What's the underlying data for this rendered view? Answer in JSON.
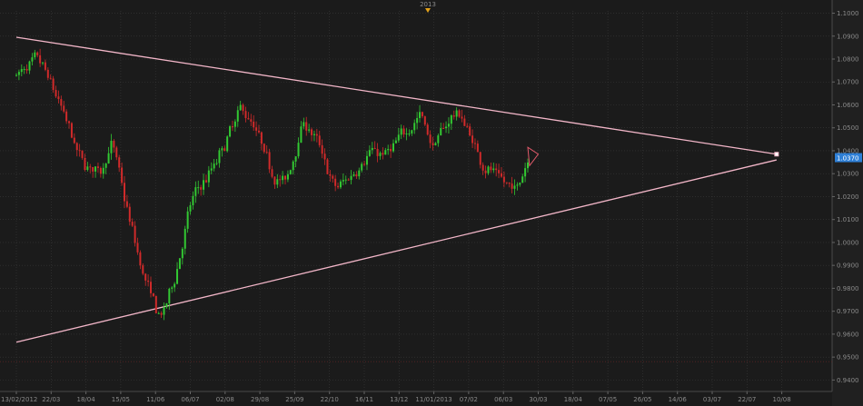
{
  "chart_data": {
    "type": "candlestick",
    "title": "",
    "xlabel": "",
    "ylabel": "",
    "grid": true,
    "ylim": [
      0.935,
      1.101
    ],
    "y_ticks": [
      "1.1000",
      "1.0900",
      "1.0800",
      "1.0700",
      "1.0600",
      "1.0500",
      "1.0400",
      "1.0300",
      "1.0200",
      "1.0100",
      "1.0000",
      "0.9900",
      "0.9800",
      "0.9700",
      "0.9600",
      "0.9500",
      "0.9400"
    ],
    "x_ticks": [
      "13/02/2012",
      "22/03",
      "18/04",
      "15/05",
      "11/06",
      "06/07",
      "02/08",
      "29/08",
      "25/09",
      "22/10",
      "16/11",
      "13/12",
      "11/01/2013",
      "07/02",
      "06/03",
      "30/03",
      "18/04",
      "07/05",
      "26/05",
      "14/06",
      "03/07",
      "22/07",
      "10/08"
    ],
    "top_marker_label": "2013",
    "current_price_label": "1.0370",
    "current_price": 1.037,
    "colors": {
      "background": "#1b1b1b",
      "grid": "#3a3a3a",
      "up": "#32c832",
      "down": "#d02a2a",
      "trendline": "#f2b6c8",
      "price_tag": "#2e7fd6",
      "marker": "#e3a21a",
      "axis_text": "#8a8a8a"
    },
    "trendlines": [
      {
        "from": {
          "x": 0,
          "y": 1.0895
        },
        "to": {
          "x": 21.85,
          "y": 1.0385
        }
      },
      {
        "from": {
          "x": 0,
          "y": 0.9565
        },
        "to": {
          "x": 21.85,
          "y": 1.036
        }
      }
    ],
    "anchors": [
      {
        "x": 0,
        "y": 1.073
      },
      {
        "x": 0.6,
        "y": 1.08
      },
      {
        "x": 1.2,
        "y": 1.06
      },
      {
        "x": 1.8,
        "y": 1.035
      },
      {
        "x": 2.4,
        "y": 1.03
      },
      {
        "x": 2.7,
        "y": 1.046
      },
      {
        "x": 3.1,
        "y": 1.015
      },
      {
        "x": 3.6,
        "y": 0.985
      },
      {
        "x": 4.1,
        "y": 0.965
      },
      {
        "x": 4.5,
        "y": 0.985
      },
      {
        "x": 5.0,
        "y": 1.02
      },
      {
        "x": 5.5,
        "y": 1.03
      },
      {
        "x": 6.0,
        "y": 1.045
      },
      {
        "x": 6.4,
        "y": 1.06
      },
      {
        "x": 6.8,
        "y": 1.05
      },
      {
        "x": 7.3,
        "y": 1.03
      },
      {
        "x": 7.7,
        "y": 1.025
      },
      {
        "x": 8.2,
        "y": 1.055
      },
      {
        "x": 8.7,
        "y": 1.04
      },
      {
        "x": 9.1,
        "y": 1.022
      },
      {
        "x": 9.6,
        "y": 1.03
      },
      {
        "x": 10.1,
        "y": 1.04
      },
      {
        "x": 10.6,
        "y": 1.038
      },
      {
        "x": 11.1,
        "y": 1.048
      },
      {
        "x": 11.6,
        "y": 1.057
      },
      {
        "x": 11.9,
        "y": 1.04
      },
      {
        "x": 12.3,
        "y": 1.052
      },
      {
        "x": 12.6,
        "y": 1.058
      },
      {
        "x": 12.9,
        "y": 1.05
      },
      {
        "x": 13.3,
        "y": 1.035
      },
      {
        "x": 13.7,
        "y": 1.03
      },
      {
        "x": 14.0,
        "y": 1.025
      },
      {
        "x": 14.3,
        "y": 1.022
      },
      {
        "x": 14.7,
        "y": 1.04
      }
    ],
    "last_candle_x": 14.7,
    "projection_triangle": [
      {
        "x": 14.7,
        "y": 1.0415
      },
      {
        "x": 15.0,
        "y": 1.0385
      },
      {
        "x": 14.75,
        "y": 1.0335
      }
    ]
  }
}
